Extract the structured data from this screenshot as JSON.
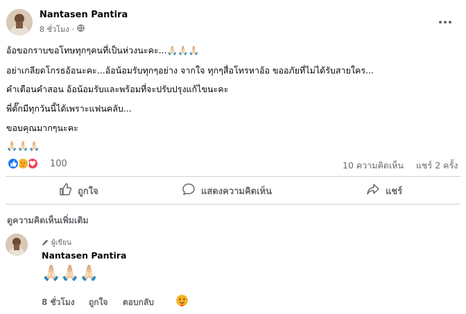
{
  "post": {
    "author": "Nantasen Pantira",
    "time": "8 ชั่วโมง",
    "privacy_icon": "globe-icon",
    "lines": [
      "อ้อขอกราบขอโทษทุกๆคนที่เป็นห่วงนะคะ...🙏🏻🙏🏻🙏🏻",
      "อย่าเกลียดโกรธอ้อนะคะ...อ้อน้อมรับทุกๆอย่าง จากใจ ทุกๆสื่อโทรหาอ้อ ขออภัยที่ไม่ได้รับสายใคร...",
      "คำเตือนคำสอน อ้อน้อมรับและพร้อมที่จะปรับปรุงแก้ไขนะคะ",
      "พี่ตั๊กมีทุกวันนี้ได้เพราะแฟนคลับ...",
      "ขอบคุณมากๆนะคะ"
    ],
    "emoji_line": "🙏🏻🙏🏻🙏🏻"
  },
  "reactions": {
    "count": "100",
    "comments": "10 ความคิดเห็น",
    "shares": "แชร์ 2 ครั้ง",
    "colors": {
      "like": "#1877f2",
      "love": "#f33e58",
      "care": "#f7b125"
    }
  },
  "actions": {
    "like": "ถูกใจ",
    "comment": "แสดงความคิดเห็น",
    "share": "แชร์"
  },
  "comments_section": {
    "more_comments": "ดูความคิดเห็นเพิ่มเติม",
    "comment": {
      "badge": "ผู้เขียน",
      "author": "Nantasen Pantira",
      "content": "🙏🏻🙏🏻🙏🏻",
      "time": "8 ชั่วโมง",
      "like": "ถูกใจ",
      "reply": "ตอบกลับ"
    }
  }
}
